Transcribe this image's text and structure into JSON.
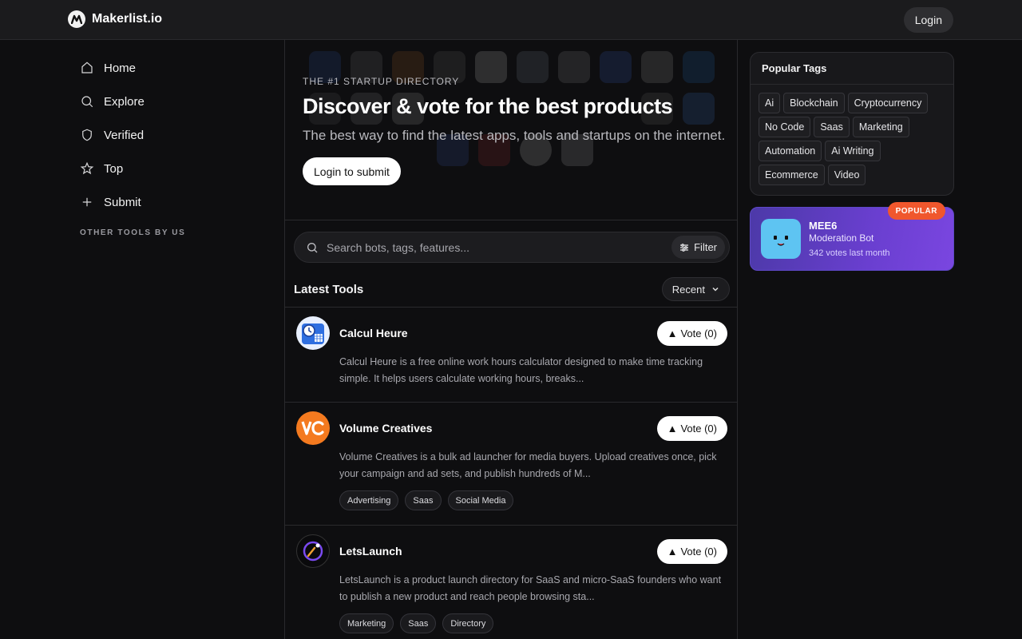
{
  "header": {
    "brand": "Makerlist.io",
    "login_label": "Login"
  },
  "sidebar": {
    "items": [
      {
        "label": "Home",
        "icon": "home-icon"
      },
      {
        "label": "Explore",
        "icon": "search-icon"
      },
      {
        "label": "Verified",
        "icon": "shield-icon"
      },
      {
        "label": "Top",
        "icon": "star-icon"
      },
      {
        "label": "Submit",
        "icon": "plus-icon"
      }
    ],
    "section_label": "OTHER TOOLS BY US"
  },
  "hero": {
    "eyebrow": "THE #1 STARTUP DIRECTORY",
    "title": "Discover & vote for the best products",
    "subtitle": "The best way to find the latest apps, tools and startups on the internet.",
    "cta_label": "Login to submit"
  },
  "search": {
    "placeholder": "Search bots, tags, features...",
    "filter_label": "Filter"
  },
  "list": {
    "title": "Latest Tools",
    "sort_label": "Recent",
    "items": [
      {
        "name": "Calcul Heure",
        "vote_label": "Vote (0)",
        "description": "Calcul Heure is a free online work hours calculator designed to make time tracking simple. It helps users calculate working hours, breaks...",
        "tags": []
      },
      {
        "name": "Volume Creatives",
        "vote_label": "Vote (0)",
        "description": "Volume Creatives is a bulk ad launcher for media buyers. Upload creatives once, pick your campaign and ad sets, and publish hundreds of M...",
        "tags": [
          "Advertising",
          "Saas",
          "Social Media"
        ]
      },
      {
        "name": "LetsLaunch",
        "vote_label": "Vote (0)",
        "description": "LetsLaunch is a product launch directory for SaaS and micro-SaaS founders who want to publish a new product and reach people browsing sta...",
        "tags": [
          "Marketing",
          "Saas",
          "Directory"
        ]
      }
    ]
  },
  "popular_tags": {
    "title": "Popular Tags",
    "tags": [
      "Ai",
      "Blockchain",
      "Cryptocurrency",
      "No Code",
      "Saas",
      "Marketing",
      "Automation",
      "Ai Writing",
      "Ecommerce",
      "Video"
    ]
  },
  "promo": {
    "badge": "POPULAR",
    "name": "MEE6",
    "category": "Moderation Bot",
    "votes": "342 votes last month"
  },
  "colors": {
    "accent_badge": "#f0572d",
    "promo_gradient_start": "#4c39a8",
    "promo_gradient_end": "#7a46e0"
  }
}
